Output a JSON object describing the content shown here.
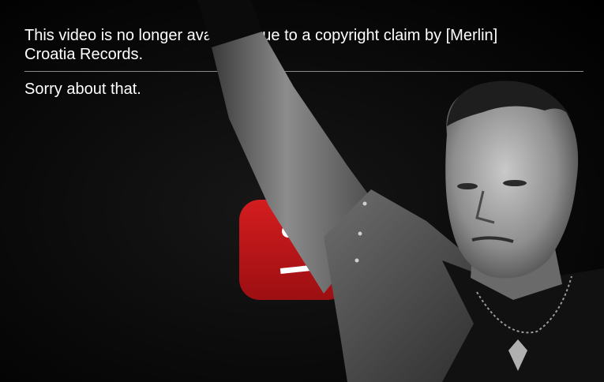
{
  "error": {
    "message_line1": "This video is no longer available due to a copyright claim by [Merlin]",
    "message_line2": "Croatia Records.",
    "apology": "Sorry about that."
  },
  "icons": {
    "error_logo": "sad-youtube-logo-icon"
  },
  "colors": {
    "background": "#000000",
    "text": "#ffffff",
    "divider": "#8a8a8a",
    "logo_red": "#c4161b"
  }
}
